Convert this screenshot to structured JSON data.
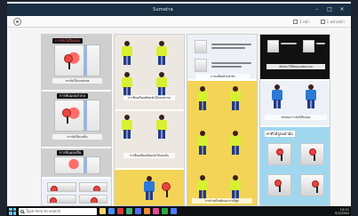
{
  "window": {
    "title": "Sumatra",
    "minimize": "–",
    "maximize": "□",
    "close": "×"
  },
  "toolbar": {
    "zoom_label": "1 หน้า",
    "view_label": "1 หน้า/หน้า",
    "icons": {
      "left": "target-icon"
    }
  },
  "pages": {
    "col1": {
      "banner1": "การจับไม้ปิงปอง",
      "banner2": "การจับแบบสากล",
      "banner3": "การจับแบบจีน",
      "caption1": "การจับไม้แบบสากล",
      "caption2": "การจับไม้แบบจีน"
    },
    "col2": {
      "caption1": "การยืนเตรียมพร้อมจับไม้แบบสากล",
      "caption2": "การยืนเตรียมพร้อมจับไม้แบบจีน"
    },
    "col3": {
      "caption1": "การเคลื่อนไหวลำตัว",
      "caption2": "การถ่ายน้ำหนักและการตีลูก"
    },
    "col4": {
      "caption1": "ลักษณะไม้ปิงปองแต่ละแบบ",
      "caption2": "ลักษณะการจับไม้ปิงปอง",
      "caption3": "ท่าตีโต้ลูกหน้ามือ"
    }
  },
  "taskbar": {
    "search_placeholder": "Type here to search",
    "time": "10:21",
    "date": "9/3/2564"
  }
}
